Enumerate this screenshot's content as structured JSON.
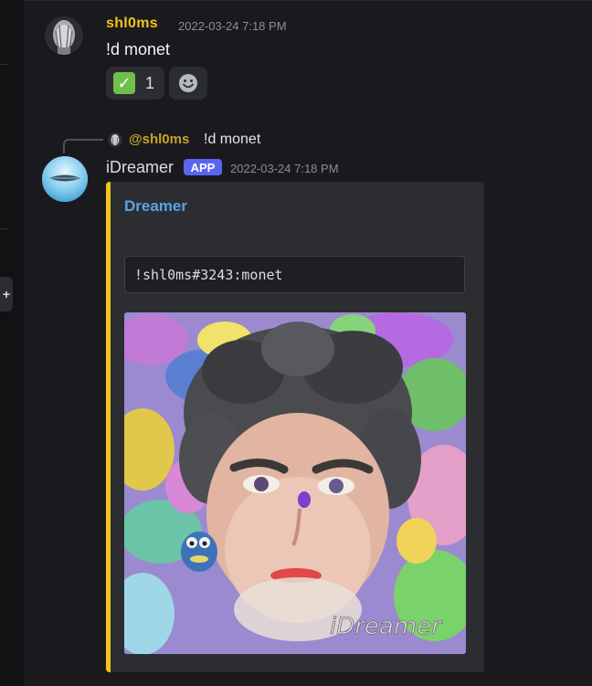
{
  "add_tab": {
    "icon": "plus-icon",
    "glyph": "+"
  },
  "message1": {
    "username": "shl0ms",
    "username_color": "#f0c419",
    "timestamp": "2022-03-24 7:18 PM",
    "content": "!d monet",
    "reactions": [
      {
        "emoji_icon": "check-mark-button-icon",
        "glyph": "✓",
        "count": "1"
      },
      {
        "emoji_icon": "add-reaction-smiley-icon"
      }
    ]
  },
  "reply": {
    "username": "@shl0ms",
    "content": "!d monet"
  },
  "message2": {
    "username": "iDreamer",
    "badge": "APP",
    "badge_color": "#5865f2",
    "timestamp": "2022-03-24 7:18 PM",
    "embed": {
      "accent_color": "#f0c419",
      "title": "Dreamer",
      "title_color": "#5aa3e8",
      "code": "!shl0ms#3243:monet",
      "image_watermark": "iDreamer"
    }
  }
}
